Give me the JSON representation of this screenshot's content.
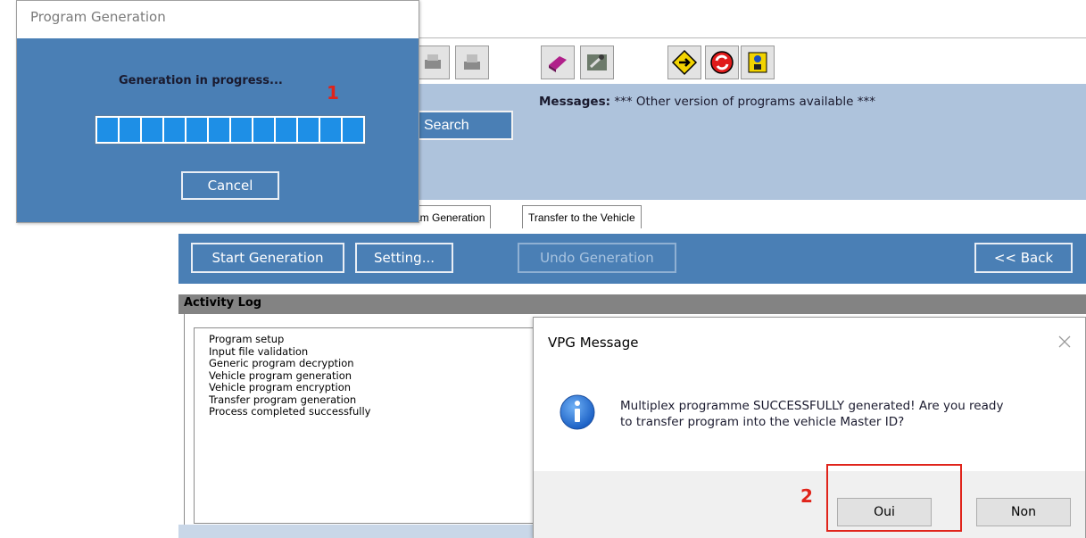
{
  "app": {
    "messages_label": "Messages:",
    "messages_text": " *** Other version of programs available ***",
    "search_label": "Search",
    "tabs": [
      "am Generation",
      "Transfer to the Vehicle"
    ],
    "actions": {
      "start_generation": "Start Generation",
      "setting": "Setting...",
      "undo_generation": "Undo Generation",
      "back": "<< Back"
    },
    "toolbar_icons": [
      "print-icon",
      "printer-icon",
      "book-icon",
      "tools-icon",
      "road-sign-icon",
      "refresh-icon",
      "help-icon"
    ]
  },
  "activity_log": {
    "title": "Activity Log",
    "lines": [
      "Program setup",
      "Input file validation",
      "Generic program decryption",
      "Vehicle program generation",
      "Vehicle program encryption",
      "Transfer program generation",
      "Process completed successfully"
    ]
  },
  "generation_dialog": {
    "title": "Program Generation",
    "status": "Generation in progress...",
    "progress": 1.0,
    "cancel_label": "Cancel"
  },
  "vpg_dialog": {
    "title": "VPG Message",
    "message_line1": "Multiplex programme SUCCESSFULLY generated! Are you ready",
    "message_line2": "to transfer program into the vehicle Master ID?",
    "yes_label": "Oui",
    "no_label": "Non"
  },
  "annotations": {
    "marker_1": "1",
    "marker_2": "2",
    "color": "#e0241b"
  },
  "colors": {
    "primary_blue": "#4a7fb5",
    "header_blue": "#aec3dc",
    "progress_blue": "#1e8fe6"
  }
}
